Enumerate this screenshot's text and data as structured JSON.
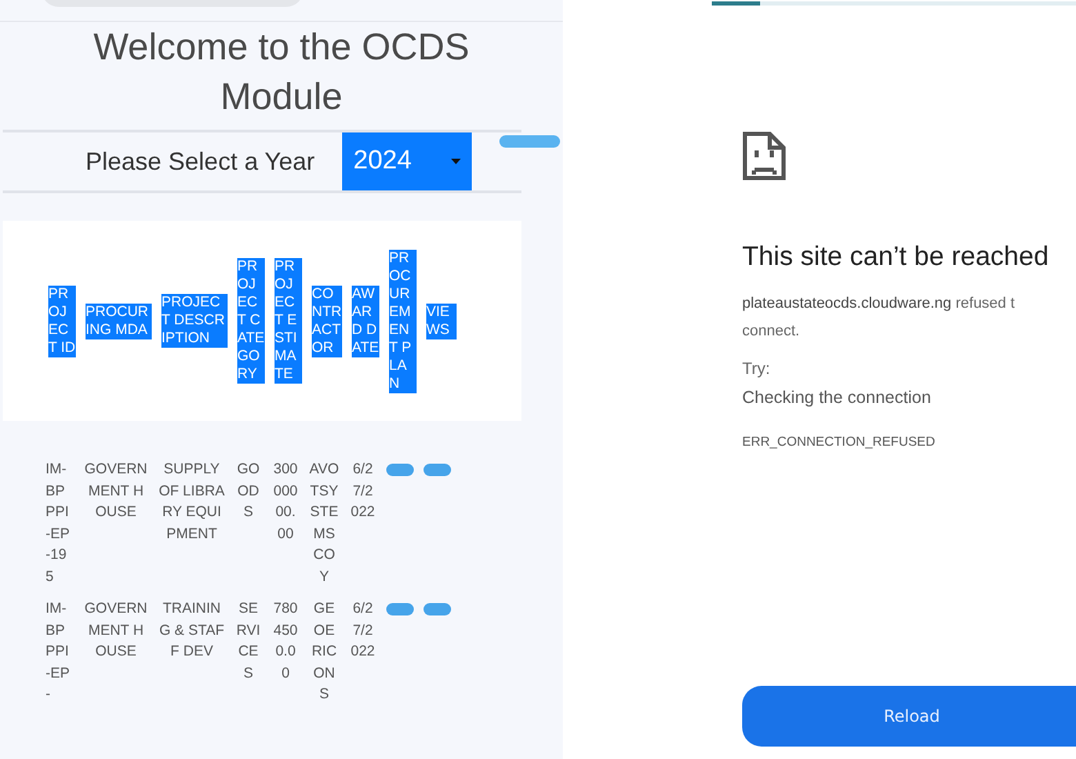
{
  "left_screen": {
    "title": "Welcome to the OCDS Module",
    "year_label": "Please Select a Year",
    "year_select": {
      "value": "2024"
    },
    "table": {
      "columns": [
        "PROJECT ID",
        "PROCURING MDA",
        "PROJECT DESCRIPTION",
        "PROJECT CATEGORY",
        "PROJECT ESTIMATE",
        "CONTRACTOR",
        "AWARD DATE",
        "PROCUREMENT PLAN",
        "VIEWS"
      ],
      "rows": [
        {
          "cells": [
            "IM-BPPPI-EP-195",
            "GOVERNMENT HOUSE",
            "SUPPLY OF LIBRARY EQUIPMENT",
            "GOODS",
            "30000000.00",
            "AVOTSYSTEMSCOY",
            "6/27/2022"
          ]
        },
        {
          "cells": [
            "IM-BPPPI-EP-",
            "GOVERNMENT HOUSE",
            "TRAINING & STAFF DEV",
            "SERVICES",
            "7804500.00",
            "GEOERICONS",
            "6/27/2022"
          ]
        }
      ]
    }
  },
  "right_screen": {
    "page_load_progress": {
      "level": 0.12
    },
    "heading": "This site can’t be reached",
    "message_line_1": "**plateaustateocds.cloudware.ng** refused t",
    "message_line_2": "connect.",
    "try_label": "Try:",
    "suggestion": "Checking the connection",
    "error_code": "ERR_CONNECTION_REFUSED",
    "reload_button": "Reload"
  }
}
